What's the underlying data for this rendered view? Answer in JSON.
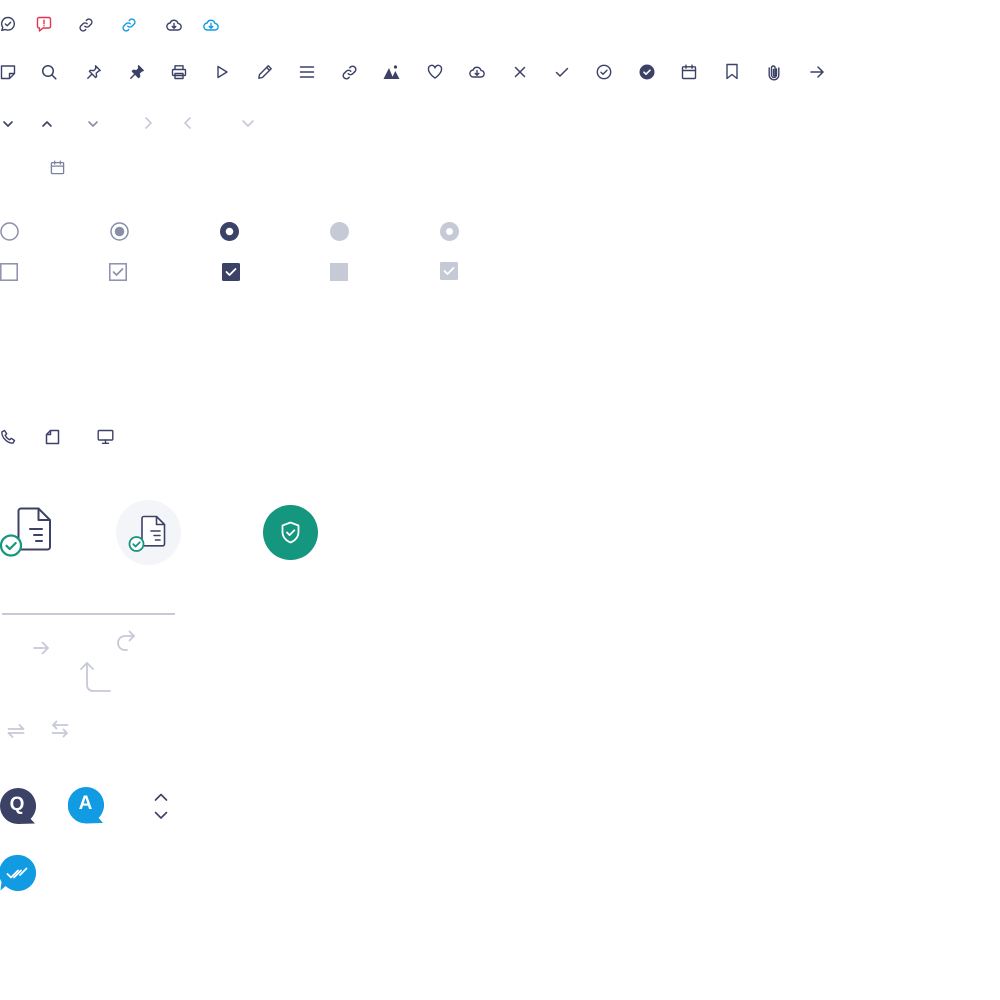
{
  "colors": {
    "icon_dark": "#3c4166",
    "error_red": "#e0344f",
    "link_blue": "#109be3",
    "disabled_grey": "#c6c9d6",
    "success_teal": "#14967f",
    "avatar_bg": "#f4f5f8"
  },
  "qa": {
    "question_badge": "Q",
    "answer_badge": "A"
  },
  "icons": {
    "row1": [
      "chat-check-icon",
      "chat-alert-icon",
      "link-icon",
      "link-active-icon",
      "cloud-download-icon",
      "cloud-download-active-icon"
    ],
    "row2": [
      "note-icon",
      "search-icon",
      "pin-icon",
      "pin-filled-icon",
      "print-icon",
      "play-icon",
      "pencil-icon",
      "list-icon",
      "link-icon",
      "image-icon",
      "heart-icon",
      "cloud-download-icon",
      "close-icon",
      "check-icon",
      "check-circle-icon",
      "check-circle-filled-icon",
      "calendar-icon",
      "bookmark-icon",
      "paperclip-icon",
      "arrow-right-icon"
    ],
    "chevrons": [
      "chevron-down-icon",
      "chevron-up-icon",
      "chevron-down-icon",
      "chevron-right-disabled-icon",
      "chevron-left-disabled-icon",
      "chevron-down-disabled-icon"
    ],
    "radios": [
      "radio-unchecked",
      "radio-hover",
      "radio-checked",
      "radio-disabled",
      "radio-checked-disabled"
    ],
    "checkboxes": [
      "checkbox-unchecked",
      "checkbox-hover",
      "checkbox-checked",
      "checkbox-disabled",
      "checkbox-checked-disabled"
    ],
    "devices": [
      "phone-icon",
      "tablet-icon",
      "desktop-icon"
    ],
    "documents": [
      "document-check-icon",
      "document-check-avatar",
      "shield-check-badge"
    ],
    "arrows": [
      "arrow-right-icon",
      "redo-icon",
      "return-up-icon",
      "swap-icon",
      "swap-icon"
    ],
    "misc": [
      "question-badge",
      "answer-badge",
      "sort-icon",
      "read-receipt-badge"
    ]
  }
}
